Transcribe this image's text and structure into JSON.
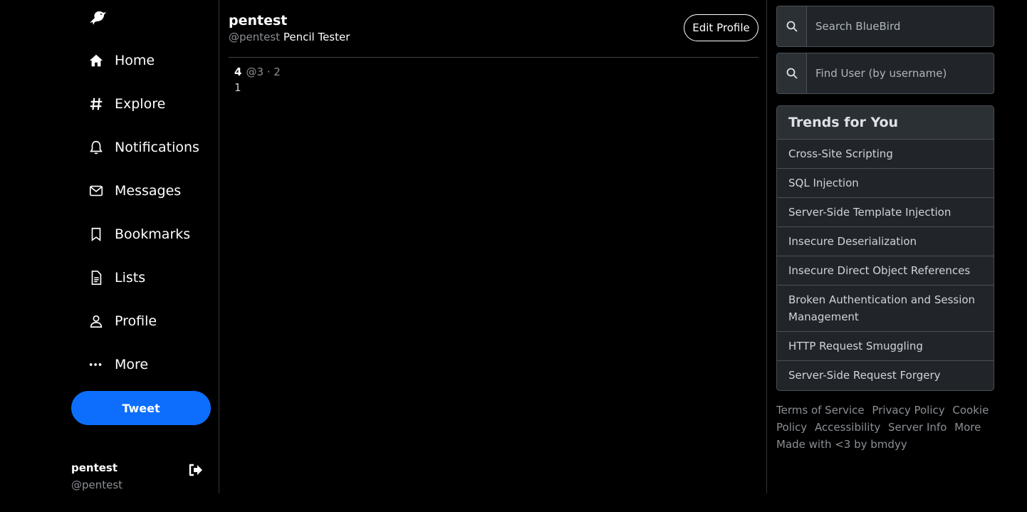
{
  "app": {
    "logo_icon": "bird-icon",
    "accent_color": "#0d6efd"
  },
  "nav": [
    {
      "key": "home",
      "label": "Home",
      "icon": "home-icon"
    },
    {
      "key": "explore",
      "label": "Explore",
      "icon": "hash-icon"
    },
    {
      "key": "notifications",
      "label": "Notifications",
      "icon": "bell-icon"
    },
    {
      "key": "messages",
      "label": "Messages",
      "icon": "envelope-icon"
    },
    {
      "key": "bookmarks",
      "label": "Bookmarks",
      "icon": "bookmark-icon"
    },
    {
      "key": "lists",
      "label": "Lists",
      "icon": "document-icon"
    },
    {
      "key": "profile",
      "label": "Profile",
      "icon": "person-icon"
    },
    {
      "key": "more",
      "label": "More",
      "icon": "more-dots-icon"
    }
  ],
  "tweet_button": {
    "label": "Tweet"
  },
  "current_user": {
    "name": "pentest",
    "handle": "@pentest"
  },
  "profile": {
    "name": "pentest",
    "handle": "@pentest",
    "display_name": "Pencil Tester",
    "edit_label": "Edit Profile"
  },
  "tweets": [
    {
      "author": "4",
      "meta": "@3 · 2",
      "body": "1"
    }
  ],
  "search": {
    "placeholder": "Search BlueBird",
    "user_placeholder": "Find User (by username)"
  },
  "trends": {
    "title": "Trends for You",
    "items": [
      "Cross-Site Scripting",
      "SQL Injection",
      "Server-Side Template Injection",
      "Insecure Deserialization",
      "Insecure Direct Object References",
      "Broken Authentication and Session Management",
      "HTTP Request Smuggling",
      "Server-Side Request Forgery"
    ]
  },
  "footer": {
    "links": [
      "Terms of Service",
      "Privacy Policy",
      "Cookie Policy",
      "Accessibility",
      "Server Info",
      "More"
    ],
    "credit": "Made with <3 by bmdyy"
  }
}
